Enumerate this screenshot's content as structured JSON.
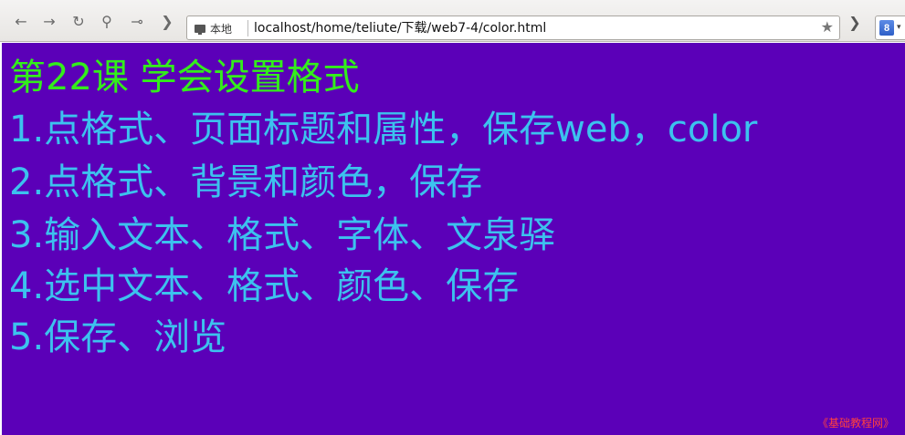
{
  "toolbar": {
    "location_chip": "本地",
    "url": "localhost/home/teliute/下载/web7-4/color.html",
    "search_engine_badge": "8",
    "icons": [
      "back-icon",
      "forward-icon",
      "reload-icon",
      "search-icon",
      "key-icon",
      "chevron-right-icon",
      "page-icon",
      "star-icon",
      "chevron-right-icon",
      "google-icon"
    ]
  },
  "content": {
    "background": "#5b00b8",
    "title": "第22课  学会设置格式",
    "title_color": "#33ee1b",
    "text_color": "#3cc2ee",
    "lines": [
      "1.点格式、页面标题和属性，保存web，color",
      "2.点格式、背景和颜色，保存",
      "3.输入文本、格式、字体、文泉驿",
      "4.选中文本、格式、颜色、保存",
      "5.保存、浏览"
    ],
    "watermark": "《基础教程网》"
  }
}
